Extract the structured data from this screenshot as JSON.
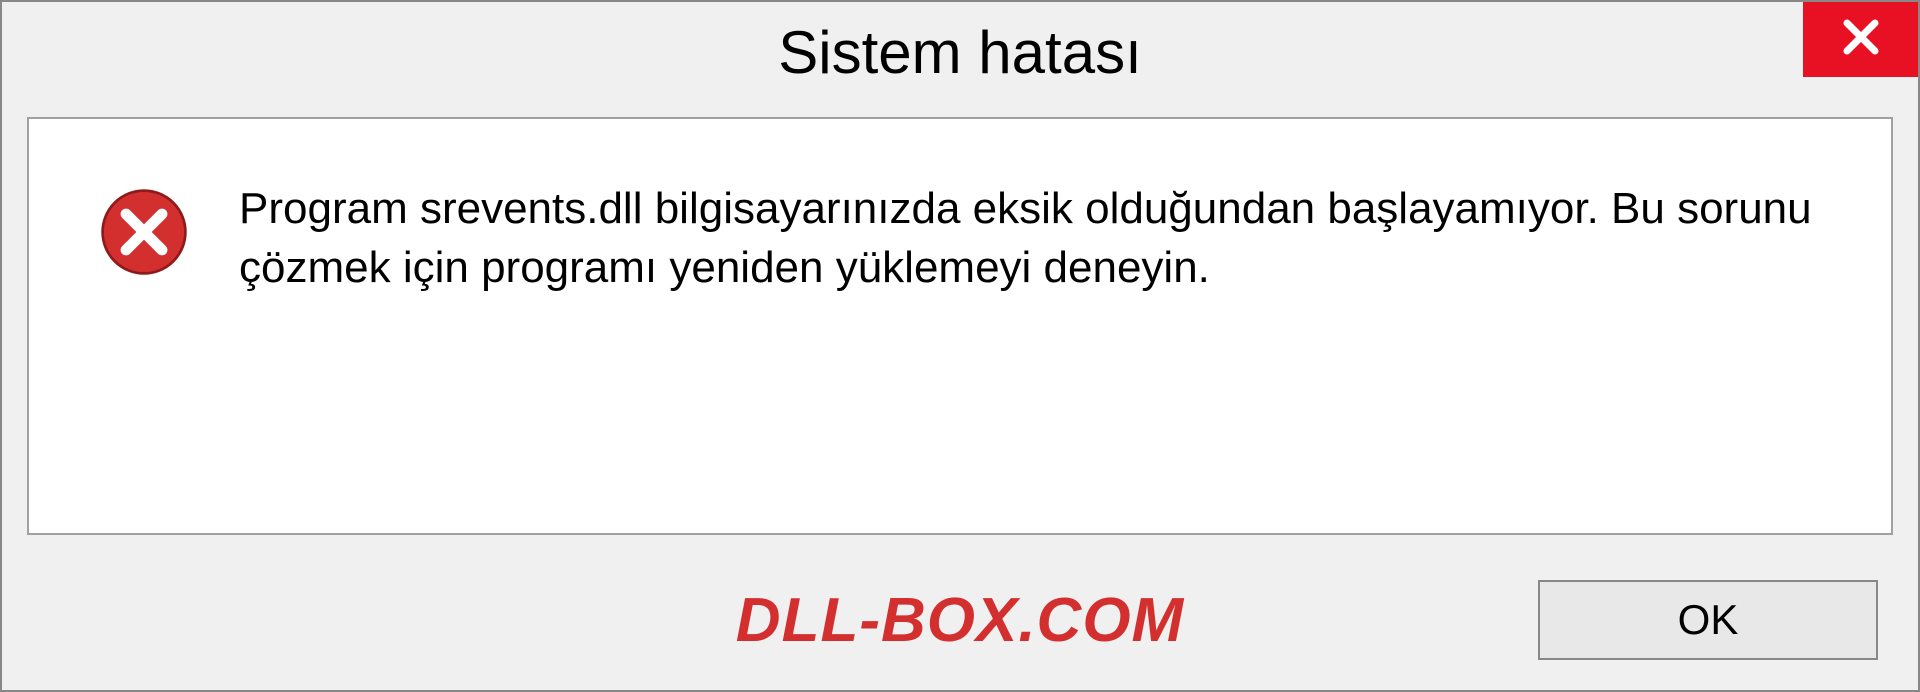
{
  "dialog": {
    "title": "Sistem hatası",
    "message": "Program srevents.dll bilgisayarınızda eksik olduğundan başlayamıyor. Bu sorunu çözmek için programı yeniden yüklemeyi deneyin.",
    "ok_label": "OK",
    "watermark": "DLL-BOX.COM"
  },
  "colors": {
    "close_bg": "#e81123",
    "error_icon": "#d32f2f",
    "watermark": "#d32f2f"
  }
}
